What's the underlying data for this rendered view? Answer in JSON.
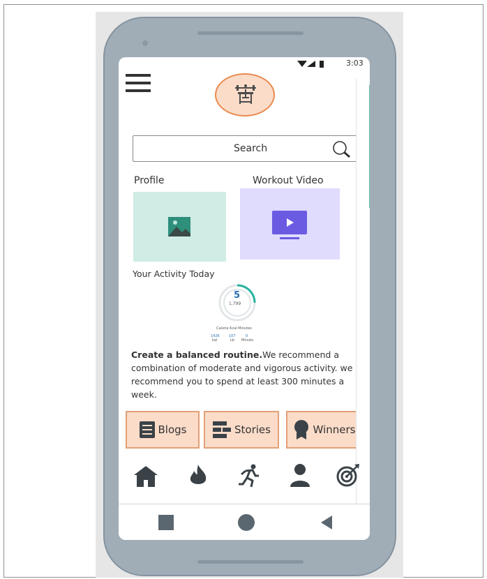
{
  "status_bar": {
    "time": "3:03"
  },
  "search": {
    "label": "Search"
  },
  "tiles": {
    "profile_label": "Profile",
    "video_label": "Workout Video"
  },
  "activity": {
    "title": "Your Activity Today",
    "ring_value": "5",
    "ring_sub": "1,799",
    "caption": "Calorie Kcal  Minutes",
    "stats": [
      "1426",
      "107",
      "0"
    ],
    "stat_units": [
      "kal",
      "Lb",
      "Minute"
    ]
  },
  "recommendation": {
    "bold": "Create a balanced routine.",
    "text": "We recommend a combination of moderate and vigorous activity. we recommend you to spend at least 300 minutes a week."
  },
  "buttons": {
    "blogs": "Blogs",
    "stories": "Stories",
    "winners": "Winners"
  },
  "icons": {
    "nav": [
      "home-icon",
      "fire-icon",
      "running-icon",
      "person-icon",
      "target-icon"
    ],
    "system": [
      "square-icon",
      "circle-icon",
      "back-triangle-icon"
    ]
  },
  "colors": {
    "accent": "#fbdcc9",
    "accent_border": "#e98a4e",
    "profile_tile": "#cfece5",
    "video_tile": "#dfdcfd",
    "video_icon": "#6b5be3",
    "ring_teal": "#27b3a0",
    "icon_dark": "#3a4247"
  }
}
